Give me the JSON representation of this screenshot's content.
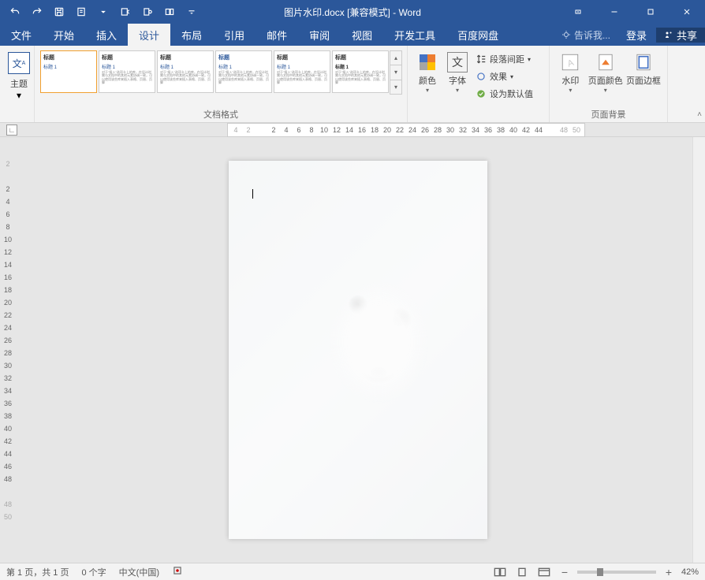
{
  "title": "图片水印.docx [兼容模式] - Word",
  "qat": {
    "undo": "↶",
    "redo": "↷",
    "save": "💾"
  },
  "tabs": [
    "文件",
    "开始",
    "插入",
    "设计",
    "布局",
    "引用",
    "邮件",
    "审阅",
    "视图",
    "开发工具",
    "百度网盘"
  ],
  "active_tab": 3,
  "tell_me": "告诉我...",
  "login": "登录",
  "share": "共享",
  "ribbon": {
    "themes_label": "主题",
    "doc_format_label": "文档格式",
    "page_bg_label": "页面背景",
    "gallery_title": "标题",
    "gallery_sub": "标题 1",
    "gallery_body": "对于\"插入\"选项卡上的库，在设计时需与文档中的其他元素协调一致，可以使用该些库来插入表格、页眉、页脚",
    "colors_label": "颜色",
    "fonts_label": "字体",
    "para_spacing": "段落间距",
    "effects": "效果",
    "set_default": "设为默认值",
    "watermark_label": "水印",
    "page_color_label": "页面颜色",
    "page_border_label": "页面边框"
  },
  "ruler_h": [
    "4",
    "2",
    "",
    "2",
    "4",
    "6",
    "8",
    "10",
    "12",
    "14",
    "16",
    "18",
    "20",
    "22",
    "24",
    "26",
    "28",
    "30",
    "32",
    "34",
    "36",
    "38",
    "40",
    "42",
    "44",
    "",
    "48",
    "50"
  ],
  "ruler_v": [
    "2",
    "",
    "2",
    "4",
    "6",
    "8",
    "10",
    "12",
    "14",
    "16",
    "18",
    "20",
    "22",
    "24",
    "26",
    "28",
    "30",
    "32",
    "34",
    "36",
    "38",
    "40",
    "42",
    "44",
    "46",
    "48",
    "",
    "48",
    "50"
  ],
  "status": {
    "page": "第 1 页，共 1 页",
    "words": "0 个字",
    "lang": "中文(中国)",
    "zoom": "42%"
  }
}
